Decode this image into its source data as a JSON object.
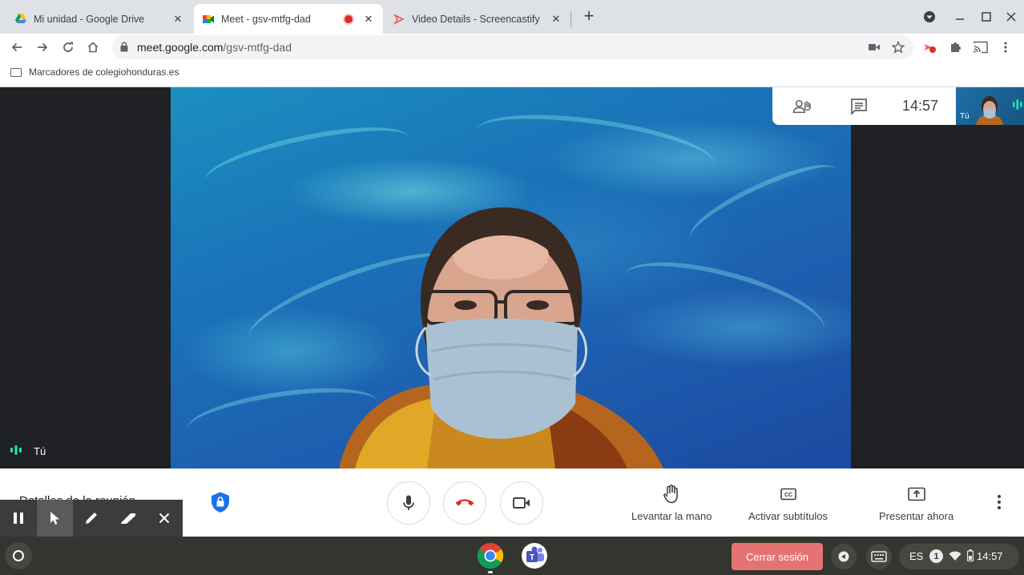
{
  "browser": {
    "tabs": [
      {
        "title": "Mi unidad - Google Drive",
        "active": false,
        "recording": false
      },
      {
        "title": "Meet - gsv-mtfg-dad",
        "active": true,
        "recording": true
      },
      {
        "title": "Video Details - Screencastify",
        "active": false,
        "recording": false
      }
    ],
    "url_host": "meet.google.com",
    "url_path": "/gsv-mtfg-dad",
    "bookmark_folder": "Marcadores de colegiohonduras.es"
  },
  "meet": {
    "clock": "14:57",
    "self_label": "Tú",
    "thumbnail_label": "Tú",
    "meeting_details_label": "Detalles de la reunión",
    "actions": {
      "raise_hand": "Levantar la mano",
      "captions": "Activar subtítulos",
      "present": "Presentar ahora"
    }
  },
  "shelf": {
    "logout_label": "Cerrar sesión",
    "language": "ES",
    "notification_count": "1",
    "time": "14:57"
  },
  "colors": {
    "tabstrip": "#dee1e6",
    "end_call_red": "#d93025",
    "logout_button": "#e57373",
    "shelf": "#33362f"
  }
}
